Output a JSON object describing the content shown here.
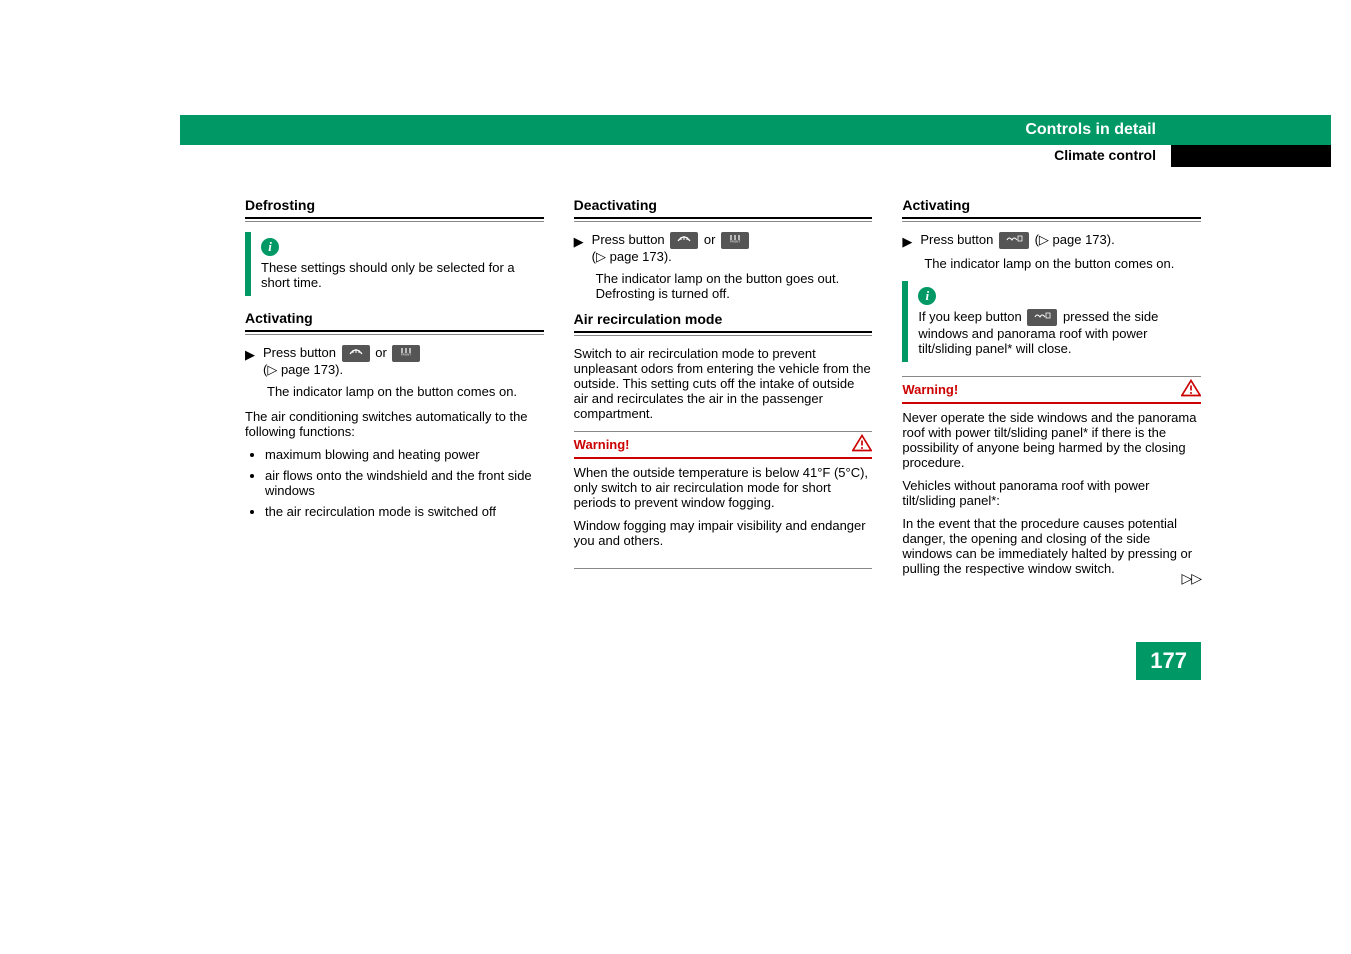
{
  "chapter_title": "Controls in detail",
  "section_title": "Climate control",
  "page_number": "177",
  "col1": {
    "defrosting_heading": "Defrosting",
    "info_note": "These settings should only be selected for a short time.",
    "activating_heading": "Activating",
    "press_button_prefix": "Press button",
    "or_text": "or",
    "page_ref": "page 173).",
    "indicator_on": "The indicator lamp on the button comes on.",
    "auto_switch": "The air conditioning switches automatically to the following functions:",
    "bullets": {
      "b1": "maximum blowing and heating power",
      "b2": "air flows onto the windshield and the front side windows",
      "b3": "the air recirculation mode is switched off"
    }
  },
  "col2": {
    "deactivating_heading": "Deactivating",
    "press_button_prefix": "Press button",
    "or_text": "or",
    "page_ref": "page 173).",
    "indicator_off": "The indicator lamp on the button goes out. Defrosting is turned off.",
    "air_recirc_heading": "Air recirculation mode",
    "air_recirc_body": "Switch to air recirculation mode to prevent unpleasant odors from entering the vehicle from the outside. This setting cuts off the intake of outside air and recirculates the air in the passenger compartment.",
    "warning_label": "Warning!",
    "warning_body_p1": "When the outside temperature is below 41°F (5°C), only switch to air recirculation mode for short periods to prevent window fogging.",
    "warning_body_p2": "Window fogging may impair visibility and endanger you and others."
  },
  "col3": {
    "activating_heading": "Activating",
    "press_button_prefix": "Press button",
    "page_ref": "page 173).",
    "indicator_on": "The indicator lamp on the button comes on.",
    "info_prefix": "If you keep button",
    "info_suffix": "pressed the side windows and panorama roof with power tilt/sliding panel* will close.",
    "warning_label": "Warning!",
    "warning_p1": "Never operate the side windows and the panorama roof with power tilt/sliding panel* if there is the possibility of anyone being harmed by the closing procedure.",
    "warning_p2": "Vehicles without panorama roof with power tilt/sliding panel*:",
    "warning_p3": "In the event that the procedure causes potential danger, the opening and closing of the side windows can be immediately halted by pressing or pulling the respective window switch."
  },
  "icons": {
    "defrost_icon": "❄",
    "front_icon": "FRONT",
    "recirc_icon": "↻"
  }
}
